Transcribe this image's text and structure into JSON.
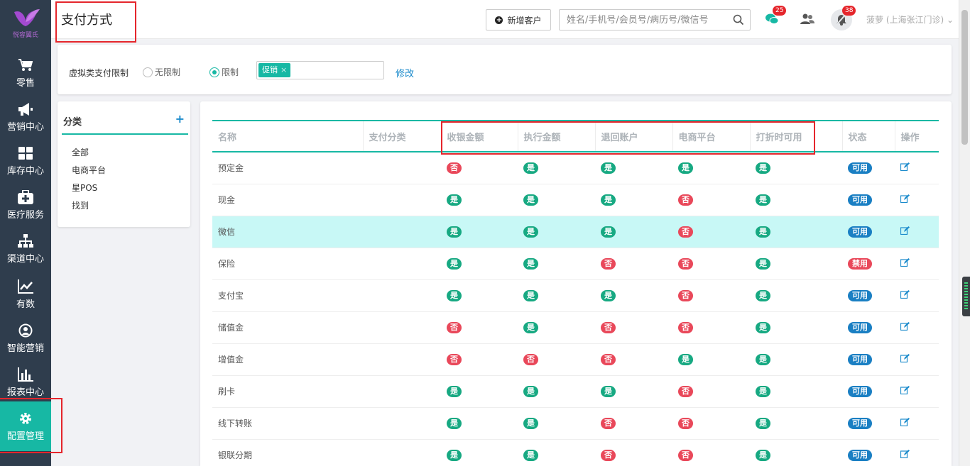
{
  "brand": {
    "logo_text": "悦容翼氏"
  },
  "sidebar": {
    "items": [
      {
        "label": "零售",
        "icon": "cart-icon"
      },
      {
        "label": "营销中心",
        "icon": "megaphone-icon"
      },
      {
        "label": "库存中心",
        "icon": "grid-icon"
      },
      {
        "label": "医疗服务",
        "icon": "medkit-icon"
      },
      {
        "label": "渠道中心",
        "icon": "sitemap-icon"
      },
      {
        "label": "有数",
        "icon": "line-chart-icon"
      },
      {
        "label": "智能营销",
        "icon": "user-circle-icon"
      },
      {
        "label": "报表中心",
        "icon": "bar-chart-icon"
      },
      {
        "label": "配置管理",
        "icon": "gear-icon",
        "active": true
      }
    ]
  },
  "header": {
    "title": "支付方式",
    "new_customer_label": "新增客户",
    "search_placeholder": "姓名/手机号/会员号/病历号/微信号",
    "chat_badge": "25",
    "notify_badge": "38",
    "user_label": "菠萝 (上海张江门诊)"
  },
  "restriction": {
    "label": "虚拟类支付限制",
    "option_none": "无限制",
    "option_limit": "限制",
    "selected": "限制",
    "tag": "促销",
    "tag_close": "×",
    "modify_label": "修改"
  },
  "categories": {
    "title": "分类",
    "add": "+",
    "items": [
      "全部",
      "电商平台",
      "星POS",
      "找到"
    ]
  },
  "table": {
    "headers": [
      "名称",
      "支付分类",
      "收银金额",
      "执行金额",
      "退回账户",
      "电商平台",
      "打折时可用",
      "状态",
      "操作"
    ],
    "rows": [
      {
        "name": "预定金",
        "category": "",
        "cashier": "否",
        "exec": "是",
        "refund": "是",
        "ecommerce": "是",
        "discount": "是",
        "status": "可用"
      },
      {
        "name": "现金",
        "category": "",
        "cashier": "是",
        "exec": "是",
        "refund": "是",
        "ecommerce": "否",
        "discount": "是",
        "status": "可用"
      },
      {
        "name": "微信",
        "category": "",
        "cashier": "是",
        "exec": "是",
        "refund": "是",
        "ecommerce": "否",
        "discount": "是",
        "status": "可用",
        "highlight": true
      },
      {
        "name": "保险",
        "category": "",
        "cashier": "是",
        "exec": "是",
        "refund": "否",
        "ecommerce": "否",
        "discount": "是",
        "status": "禁用"
      },
      {
        "name": "支付宝",
        "category": "",
        "cashier": "是",
        "exec": "是",
        "refund": "是",
        "ecommerce": "否",
        "discount": "是",
        "status": "可用"
      },
      {
        "name": "储值金",
        "category": "",
        "cashier": "否",
        "exec": "是",
        "refund": "否",
        "ecommerce": "否",
        "discount": "是",
        "status": "可用"
      },
      {
        "name": "增值金",
        "category": "",
        "cashier": "否",
        "exec": "否",
        "refund": "否",
        "ecommerce": "是",
        "discount": "是",
        "status": "可用"
      },
      {
        "name": "刷卡",
        "category": "",
        "cashier": "是",
        "exec": "是",
        "refund": "是",
        "ecommerce": "否",
        "discount": "是",
        "status": "可用"
      },
      {
        "name": "线下转账",
        "category": "",
        "cashier": "是",
        "exec": "是",
        "refund": "否",
        "ecommerce": "否",
        "discount": "是",
        "status": "可用"
      },
      {
        "name": "银联分期",
        "category": "",
        "cashier": "是",
        "exec": "是",
        "refund": "否",
        "ecommerce": "否",
        "discount": "是",
        "status": "可用"
      }
    ]
  },
  "colors": {
    "sidebar_bg": "#2f3d4d",
    "accent": "#17b8a4",
    "yes": "#17a982",
    "no": "#e9485a",
    "status_ok": "#1a7fc3",
    "highlight_border": "#e5262c",
    "row_highlight": "#c8f8f6"
  }
}
